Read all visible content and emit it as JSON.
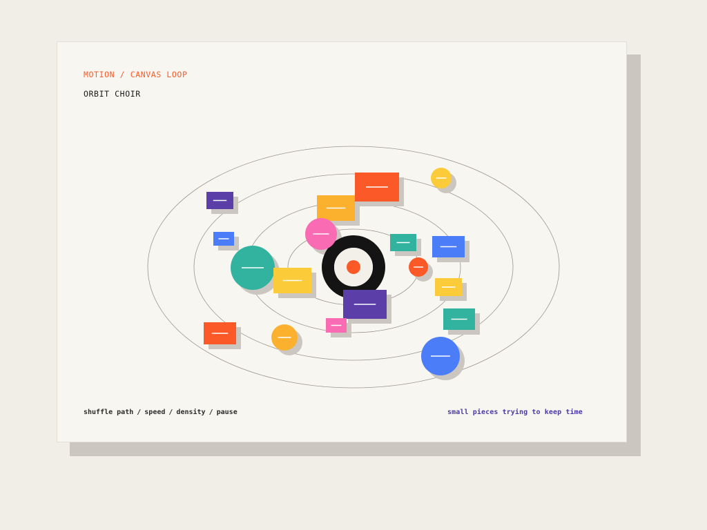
{
  "card": {
    "eyebrow": "MOTION / CANVAS LOOP",
    "title": "ORBIT CHOIR"
  },
  "controls": {
    "items": [
      "shuffle path",
      "speed",
      "density",
      "pause"
    ],
    "separator": "/"
  },
  "tagline": "small pieces trying to keep time",
  "colors": {
    "orange": "#fb5a28",
    "yellow": "#fbcb39",
    "amber": "#fbb12e",
    "teal": "#32b3a0",
    "blue": "#4b7df8",
    "purple": "#5b3ea8",
    "pink": "#f96bb2",
    "hub": "#141414",
    "hub_center": "#fb5a28",
    "orbit_line": "#9a948c",
    "shadow": "#cbc6bf",
    "page_bg": "#f1eee8",
    "card_bg": "#f8f6f0",
    "tagline": "#4b3aa3"
  },
  "orbits": {
    "count": 4
  },
  "pieces": [
    {
      "shape": "rect",
      "color": "orange"
    },
    {
      "shape": "rect",
      "color": "amber"
    },
    {
      "shape": "circle",
      "color": "yellow"
    },
    {
      "shape": "rect",
      "color": "purple"
    },
    {
      "shape": "circle",
      "color": "pink"
    },
    {
      "shape": "rect",
      "color": "blue"
    },
    {
      "shape": "rect",
      "color": "teal"
    },
    {
      "shape": "rect",
      "color": "blue"
    },
    {
      "shape": "circle",
      "color": "teal"
    },
    {
      "shape": "rect",
      "color": "yellow"
    },
    {
      "shape": "circle",
      "color": "orange"
    },
    {
      "shape": "rect",
      "color": "purple"
    },
    {
      "shape": "rect",
      "color": "yellow"
    },
    {
      "shape": "rect",
      "color": "teal"
    },
    {
      "shape": "rect",
      "color": "pink"
    },
    {
      "shape": "rect",
      "color": "orange"
    },
    {
      "shape": "circle",
      "color": "amber"
    },
    {
      "shape": "circle",
      "color": "blue"
    }
  ]
}
